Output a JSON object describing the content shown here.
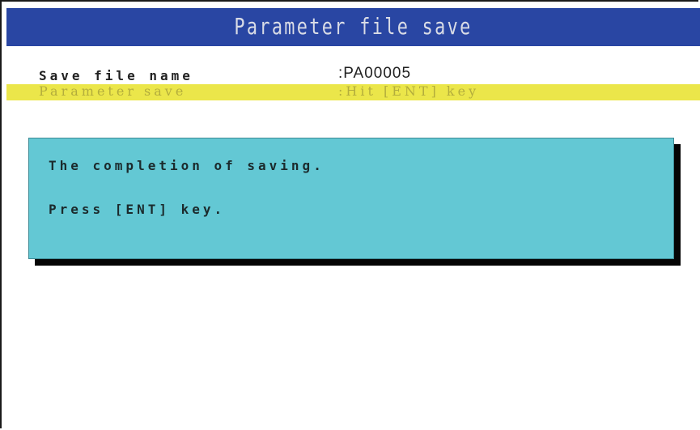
{
  "title": "Parameter file save",
  "fields": {
    "save_file_name": {
      "label": "Save file name",
      "value": ":PA00005"
    },
    "parameter_save": {
      "label": "Parameter save",
      "value": ":Hit [ENT] key"
    }
  },
  "dialog": {
    "line1": "The completion of saving.",
    "line2": "Press [ENT] key."
  },
  "colors": {
    "title_bar": "#2946a3",
    "highlight_row": "#ebe64a",
    "dialog_background": "#63c8d4",
    "dialog_shadow": "#050505"
  }
}
